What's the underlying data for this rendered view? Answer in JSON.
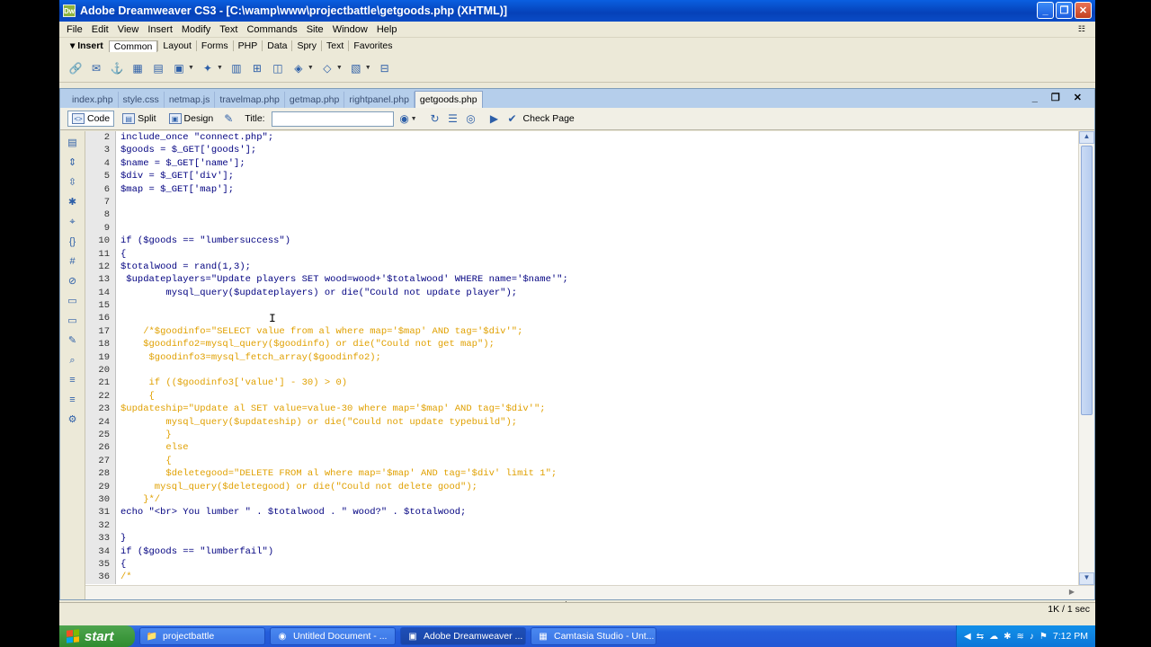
{
  "window": {
    "title": "Adobe Dreamweaver CS3 - [C:\\wamp\\www\\projectbattle\\getgoods.php (XHTML)]",
    "logo": "Dw",
    "btn_minimize": "_",
    "btn_restore": "❐",
    "btn_close": "✕"
  },
  "menu": [
    "File",
    "Edit",
    "View",
    "Insert",
    "Modify",
    "Text",
    "Commands",
    "Site",
    "Window",
    "Help"
  ],
  "insert_bar": {
    "title": "▾ Insert",
    "tabs": [
      "Common",
      "Layout",
      "Forms",
      "PHP",
      "Data",
      "Spry",
      "Text",
      "Favorites"
    ],
    "active_tab": "Common"
  },
  "doc_tabs": {
    "tabs": [
      "index.php",
      "style.css",
      "netmap.js",
      "travelmap.php",
      "getmap.php",
      "rightpanel.php",
      "getgoods.php"
    ],
    "active": "getgoods.php",
    "controls": "_ ❐ ✕"
  },
  "doc_toolbar": {
    "code_label": "Code",
    "split_label": "Split",
    "design_label": "Design",
    "title_label": "Title:",
    "title_value": "",
    "check_page_label": "Check Page"
  },
  "code_lines": [
    {
      "n": "2",
      "t": "include_once \"connect.php\";",
      "c": false
    },
    {
      "n": "3",
      "t": "$goods = $_GET['goods'];",
      "c": false
    },
    {
      "n": "4",
      "t": "$name = $_GET['name'];",
      "c": false
    },
    {
      "n": "5",
      "t": "$div = $_GET['div'];",
      "c": false
    },
    {
      "n": "6",
      "t": "$map = $_GET['map'];",
      "c": false
    },
    {
      "n": "7",
      "t": "",
      "c": false
    },
    {
      "n": "8",
      "t": "",
      "c": false
    },
    {
      "n": "9",
      "t": "",
      "c": false
    },
    {
      "n": "10",
      "t": "if ($goods == \"lumbersuccess\")",
      "c": false
    },
    {
      "n": "11",
      "t": "{",
      "c": false
    },
    {
      "n": "12",
      "t": "$totalwood = rand(1,3);",
      "c": false
    },
    {
      "n": "13",
      "t": " $updateplayers=\"Update players SET wood=wood+'$totalwood' WHERE name='$name'\";",
      "c": false
    },
    {
      "n": "14",
      "t": "        mysql_query($updateplayers) or die(\"Could not update player\");",
      "c": false
    },
    {
      "n": "15",
      "t": "",
      "c": false
    },
    {
      "n": "16",
      "t": "",
      "c": false
    },
    {
      "n": "17",
      "t": "    /*$goodinfo=\"SELECT value from al where map='$map' AND tag='$div'\";",
      "c": true
    },
    {
      "n": "18",
      "t": "    $goodinfo2=mysql_query($goodinfo) or die(\"Could not get map\");",
      "c": true
    },
    {
      "n": "19",
      "t": "     $goodinfo3=mysql_fetch_array($goodinfo2);",
      "c": true
    },
    {
      "n": "20",
      "t": "",
      "c": true
    },
    {
      "n": "21",
      "t": "     if (($goodinfo3['value'] - 30) > 0)",
      "c": true
    },
    {
      "n": "22",
      "t": "     {",
      "c": true
    },
    {
      "n": "23",
      "t": "$updateship=\"Update al SET value=value-30 where map='$map' AND tag='$div'\";",
      "c": true
    },
    {
      "n": "24",
      "t": "        mysql_query($updateship) or die(\"Could not update typebuild\");",
      "c": true
    },
    {
      "n": "25",
      "t": "        }",
      "c": true
    },
    {
      "n": "26",
      "t": "        else",
      "c": true
    },
    {
      "n": "27",
      "t": "        {",
      "c": true
    },
    {
      "n": "28",
      "t": "        $deletegood=\"DELETE FROM al where map='$map' AND tag='$div' limit 1\";",
      "c": true
    },
    {
      "n": "29",
      "t": "      mysql_query($deletegood) or die(\"Could not delete good\");",
      "c": true
    },
    {
      "n": "30",
      "t": "    }*/",
      "c": true
    },
    {
      "n": "31",
      "t": "echo \"<br> You lumber \" . $totalwood . \" wood?\" . $totalwood;",
      "c": false
    },
    {
      "n": "32",
      "t": "",
      "c": false
    },
    {
      "n": "33",
      "t": "}",
      "c": false
    },
    {
      "n": "34",
      "t": "if ($goods == \"lumberfail\")",
      "c": false
    },
    {
      "n": "35",
      "t": "{",
      "c": false
    },
    {
      "n": "36",
      "t": "/*",
      "c": true
    }
  ],
  "status": "1K / 1 sec",
  "taskbar": {
    "start": "start",
    "tasks": [
      "projectbattle",
      "Untitled Document - ...",
      "Adobe Dreamweaver ...",
      "Camtasia Studio - Unt..."
    ],
    "active_task": "Adobe Dreamweaver ...",
    "clock": "7:12 PM"
  },
  "colors": {
    "titlebar": "#0a5fe0",
    "code_text": "#000080",
    "comment_text": "#e0a000",
    "taskbar": "#245edb",
    "start_button": "#3c9a3c"
  }
}
